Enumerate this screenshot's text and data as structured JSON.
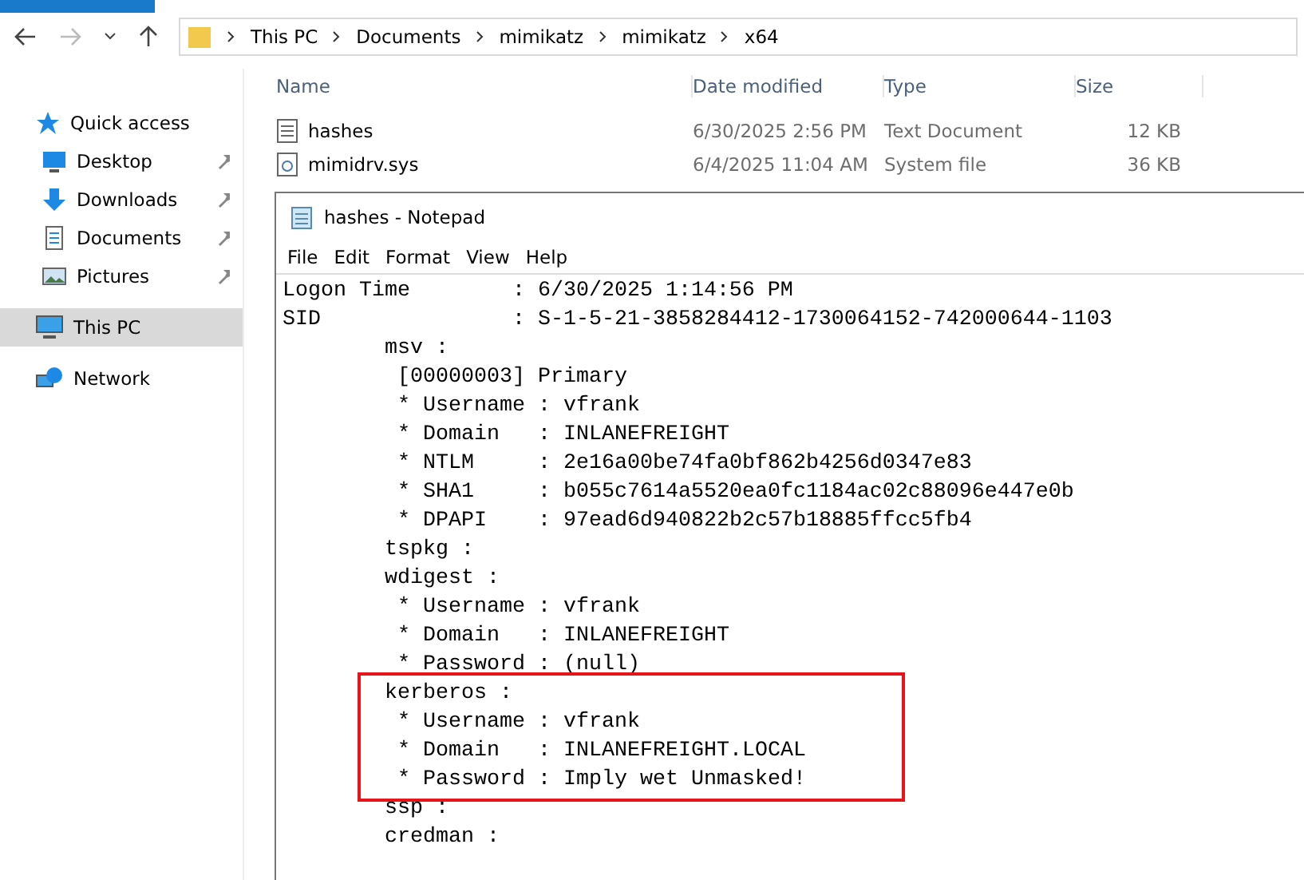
{
  "explorer": {
    "breadcrumb": [
      "This PC",
      "Documents",
      "mimikatz",
      "mimikatz",
      "x64"
    ],
    "columns": [
      "Name",
      "Date modified",
      "Type",
      "Size"
    ],
    "files": [
      {
        "name": "hashes",
        "date": "6/30/2025 2:56 PM",
        "type": "Text Document",
        "size": "12 KB",
        "kind": "text"
      },
      {
        "name": "mimidrv.sys",
        "date": "6/4/2025 11:04 AM",
        "type": "System file",
        "size": "36 KB",
        "kind": "system"
      }
    ],
    "sidebar": [
      {
        "label": "Quick access",
        "kind": "star",
        "pinned": false,
        "selected": false
      },
      {
        "label": "Desktop",
        "kind": "desktop",
        "pinned": true,
        "selected": false
      },
      {
        "label": "Downloads",
        "kind": "download",
        "pinned": true,
        "selected": false
      },
      {
        "label": "Documents",
        "kind": "document",
        "pinned": true,
        "selected": false
      },
      {
        "label": "Pictures",
        "kind": "picture",
        "pinned": true,
        "selected": false
      },
      {
        "label": "This PC",
        "kind": "pc",
        "pinned": false,
        "selected": true
      },
      {
        "label": "Network",
        "kind": "network",
        "pinned": false,
        "selected": false
      }
    ]
  },
  "notepad": {
    "title": "hashes - Notepad",
    "menu": [
      "File",
      "Edit",
      "Format",
      "View",
      "Help"
    ],
    "lines": [
      {
        "text": "Logon Time        : 6/30/2025 1:14:56 PM",
        "highlighted": false
      },
      {
        "text": "SID               : S-1-5-21-3858284412-1730064152-742000644-1103",
        "highlighted": false
      },
      {
        "text": "\tmsv :",
        "highlighted": false
      },
      {
        "text": "\t [00000003] Primary",
        "highlighted": false
      },
      {
        "text": "\t * Username : vfrank",
        "highlighted": false
      },
      {
        "text": "\t * Domain   : INLANEFREIGHT",
        "highlighted": false
      },
      {
        "text": "\t * NTLM     : 2e16a00be74fa0bf862b4256d0347e83",
        "highlighted": false
      },
      {
        "text": "\t * SHA1     : b055c7614a5520ea0fc1184ac02c88096e447e0b",
        "highlighted": false
      },
      {
        "text": "\t * DPAPI    : 97ead6d940822b2c57b18885ffcc5fb4",
        "highlighted": false
      },
      {
        "text": "\ttspkg :",
        "highlighted": false
      },
      {
        "text": "\twdigest :",
        "highlighted": false
      },
      {
        "text": "\t * Username : vfrank",
        "highlighted": false
      },
      {
        "text": "\t * Domain   : INLANEFREIGHT",
        "highlighted": false
      },
      {
        "text": "\t * Password : (null)",
        "highlighted": false
      },
      {
        "text": "\tkerberos :",
        "highlighted": true
      },
      {
        "text": "\t * Username : vfrank",
        "highlighted": true
      },
      {
        "text": "\t * Domain   : INLANEFREIGHT.LOCAL",
        "highlighted": true
      },
      {
        "text": "\t * Password : Imply wet Unmasked!",
        "highlighted": true
      },
      {
        "text": "\tssp :",
        "highlighted": false
      },
      {
        "text": "\tcredman :",
        "highlighted": false
      }
    ]
  }
}
